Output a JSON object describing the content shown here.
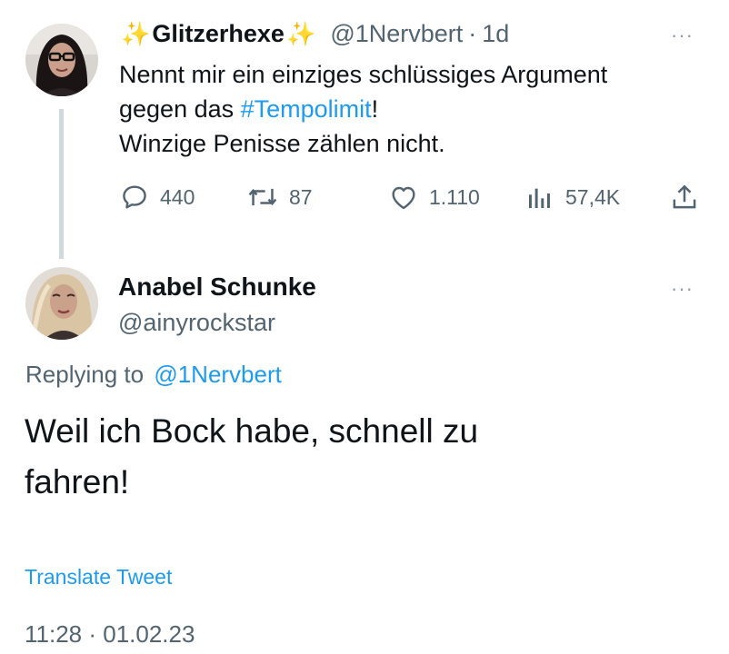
{
  "original_tweet": {
    "name_prefix": "✨",
    "name": "Glitzerhexe",
    "name_suffix": "✨",
    "handle": "@1Nervbert",
    "separator": "·",
    "age": "1d",
    "text_line1": "Nennt mir ein einziges schlüssiges Argument",
    "text_line2_before": "gegen das ",
    "hashtag": "#Tempolimit",
    "text_line2_after": "!",
    "text_line3": "Winzige Penisse zählen nicht.",
    "more": "···",
    "actions": {
      "replies": "440",
      "retweets": "87",
      "likes": "1.110",
      "views": "57,4K"
    }
  },
  "reply_tweet": {
    "name": "Anabel Schunke",
    "handle": "@ainyrockstar",
    "more": "···",
    "replying_to_label": "Replying to",
    "replying_to_handle": "@1Nervbert",
    "text_line1": "Weil ich Bock habe, schnell zu",
    "text_line2": "fahren!",
    "translate_label": "Translate Tweet",
    "timestamp": "11:28 · 01.02.23"
  },
  "colors": {
    "link": "#1d9bf0",
    "muted": "#536471",
    "sparkle": "#f5c84c",
    "thread_line": "#cfd9de"
  }
}
